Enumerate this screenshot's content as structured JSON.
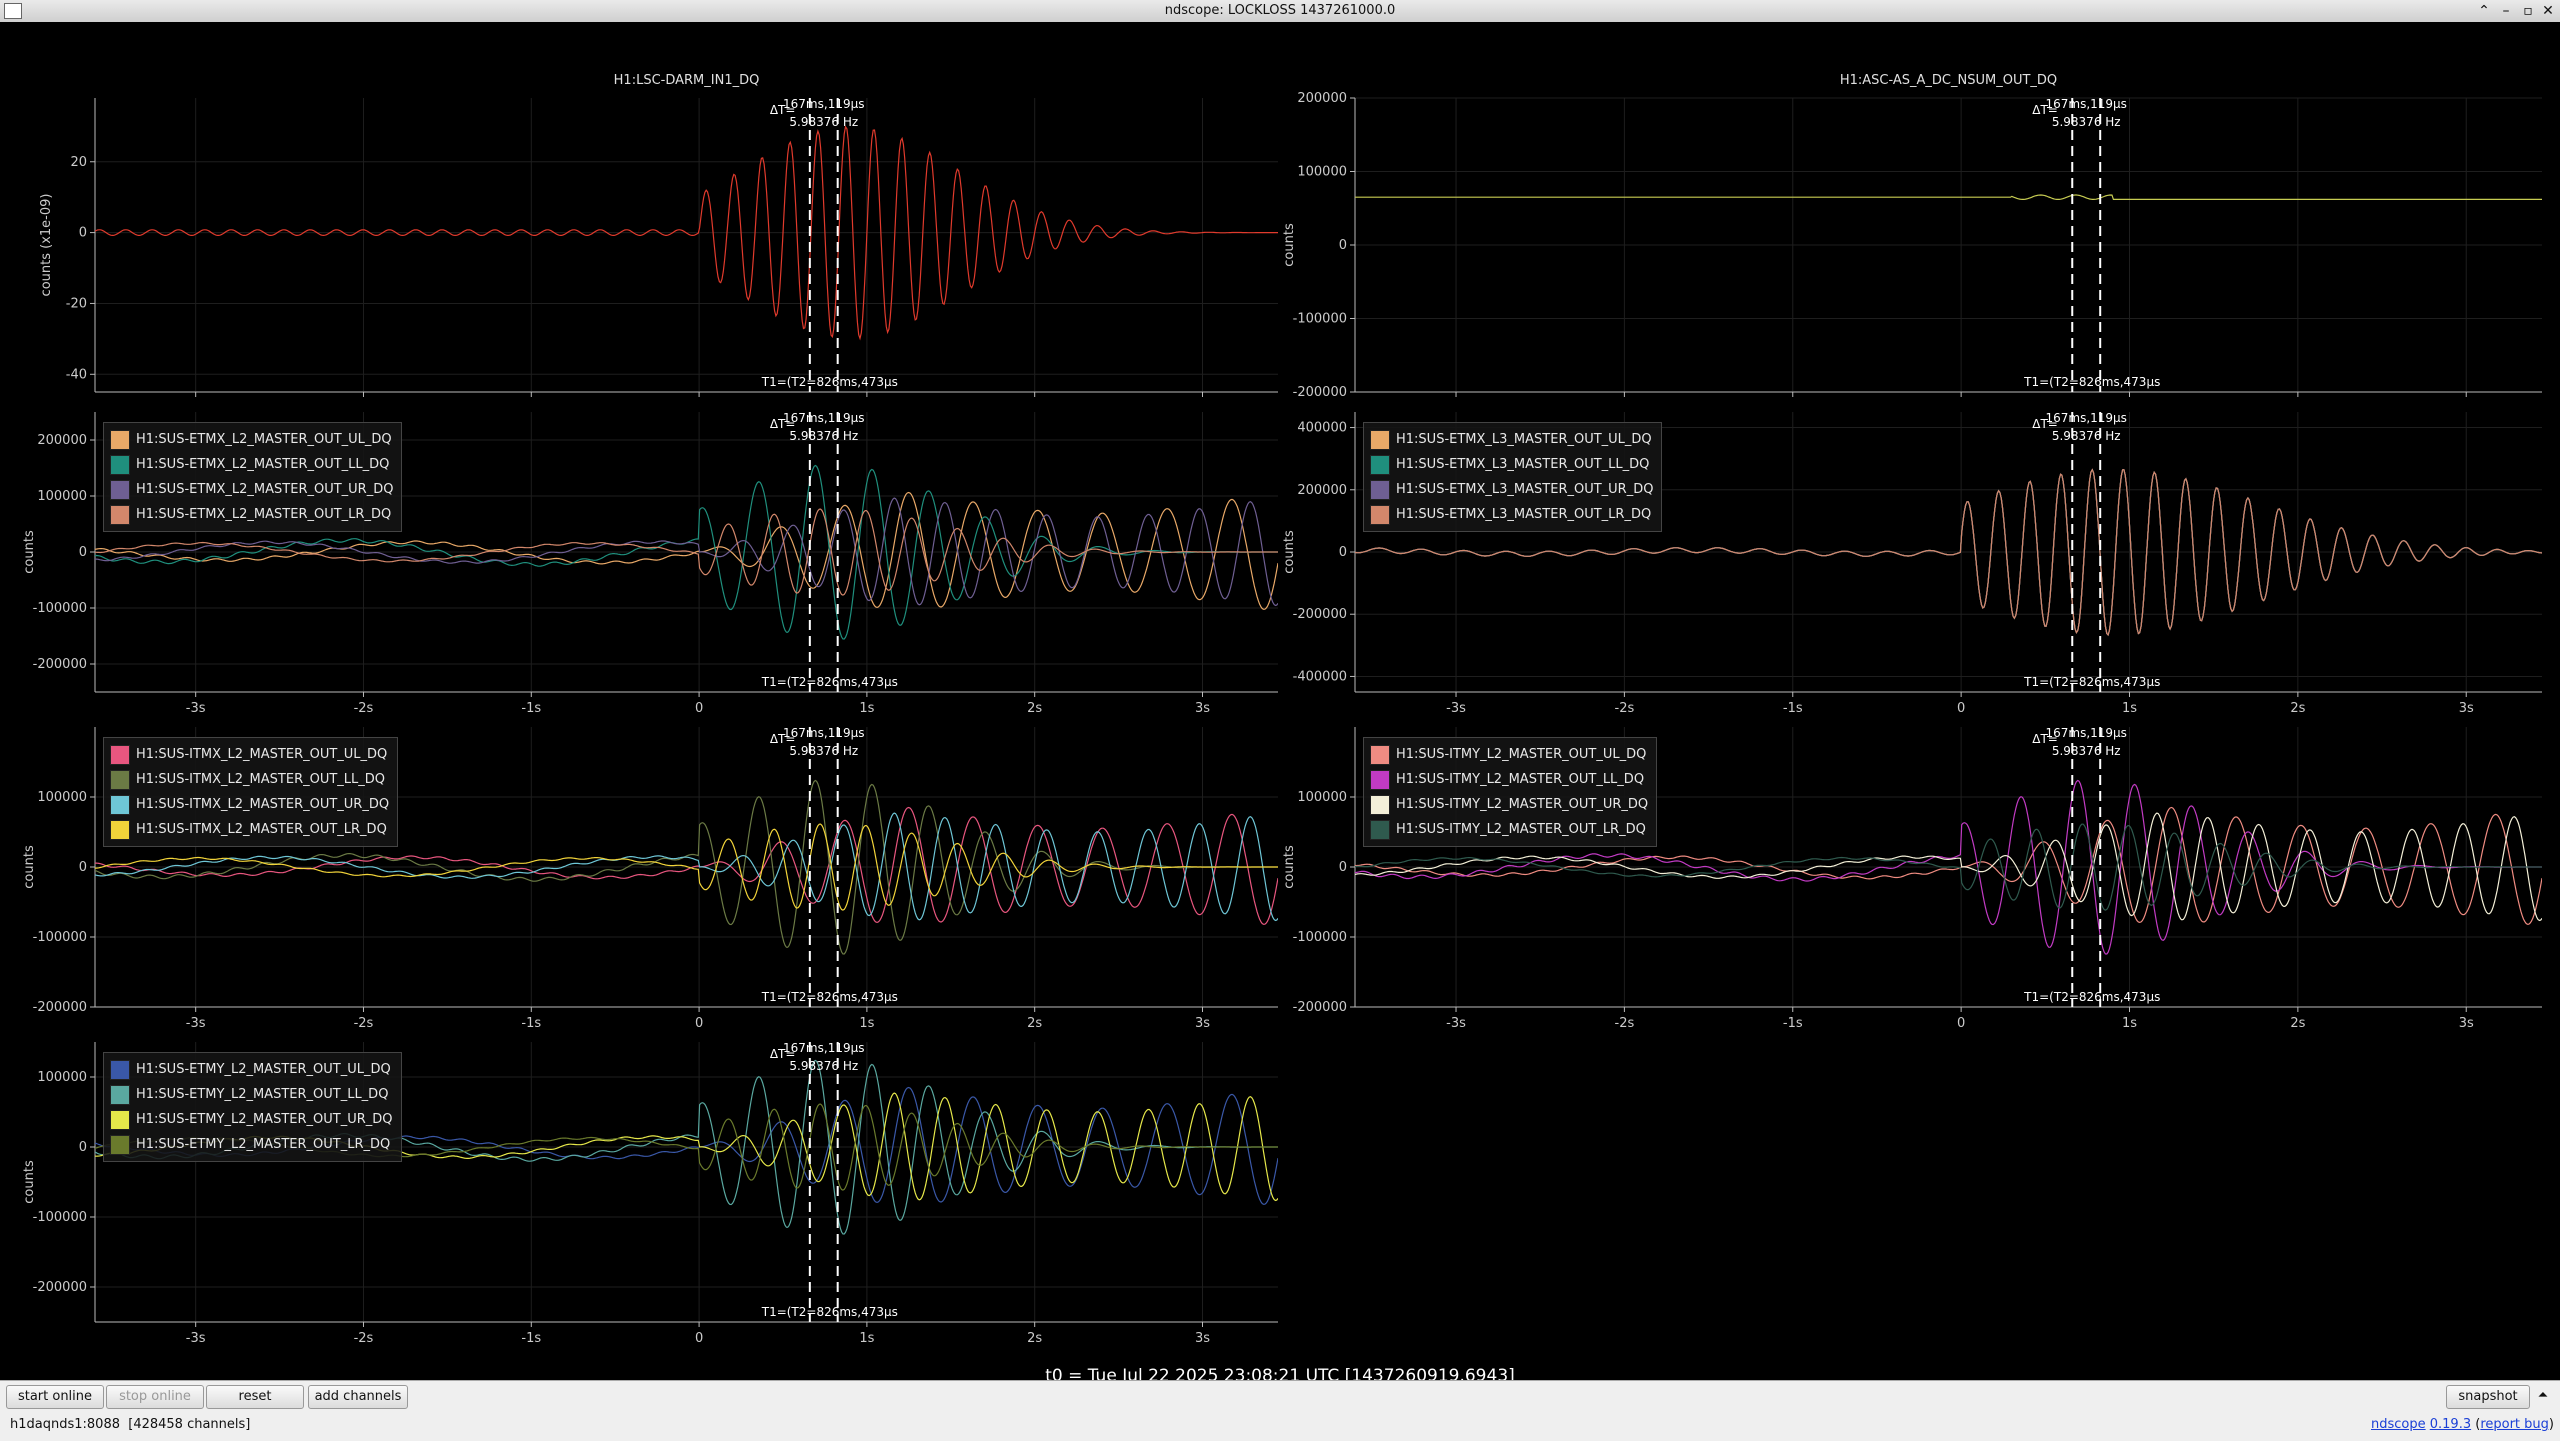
{
  "window": {
    "title": "ndscope: LOCKLOSS 1437261000.0"
  },
  "x_ticks": [
    "-3s",
    "-2s",
    "-1s",
    "0",
    "1s",
    "2s",
    "3s"
  ],
  "cursor": {
    "dt_prefix": "ΔT=",
    "dt_value": "167ms,119µs",
    "freq": "5.98376 Hz",
    "t_label": "T1=(T2=826ms,473µs"
  },
  "t0": "t0 = Tue Jul 22 2025 23:08:21 UTC [1437260919.6943]",
  "toolbar": {
    "start_online": "start online",
    "stop_online": "stop online",
    "reset": "reset",
    "add_channels": "add channels",
    "snapshot": "snapshot"
  },
  "status": {
    "server": "h1daqnds1:8088",
    "channels": "[428458 channels]",
    "version_prefix": "ndscope",
    "version": "0.19.3",
    "report": "report bug"
  },
  "colors": {
    "darm": "#e03a2c",
    "nsum": "#c7cc52"
  },
  "panels": [
    {
      "id": "p1",
      "title": "H1:LSC-DARM_IN1_DQ",
      "ylabel": "counts (x1e-09)",
      "yticks": [
        "20",
        "0",
        "-20",
        "-40"
      ],
      "ylim": [
        -45,
        38
      ],
      "legend": []
    },
    {
      "id": "p2",
      "title": "H1:ASC-AS_A_DC_NSUM_OUT_DQ",
      "ylabel": "counts",
      "yticks": [
        "200000",
        "100000",
        "0",
        "-100000",
        "-200000"
      ],
      "ylim": [
        -200000,
        200000
      ],
      "legend": []
    },
    {
      "id": "p3",
      "title": "",
      "ylabel": "counts",
      "yticks": [
        "200000",
        "100000",
        "0",
        "-100000",
        "-200000"
      ],
      "ylim": [
        -250000,
        250000
      ],
      "legend": [
        {
          "name": "H1:SUS-ETMX_L2_MASTER_OUT_UL_DQ",
          "color": "#e9a968"
        },
        {
          "name": "H1:SUS-ETMX_L2_MASTER_OUT_LL_DQ",
          "color": "#1f8f7d"
        },
        {
          "name": "H1:SUS-ETMX_L2_MASTER_OUT_UR_DQ",
          "color": "#6f5f93"
        },
        {
          "name": "H1:SUS-ETMX_L2_MASTER_OUT_LR_DQ",
          "color": "#d2876b"
        }
      ]
    },
    {
      "id": "p4",
      "title": "",
      "ylabel": "counts",
      "yticks": [
        "400000",
        "200000",
        "0",
        "-200000",
        "-400000"
      ],
      "ylim": [
        -450000,
        450000
      ],
      "legend": [
        {
          "name": "H1:SUS-ETMX_L3_MASTER_OUT_UL_DQ",
          "color": "#e9a968"
        },
        {
          "name": "H1:SUS-ETMX_L3_MASTER_OUT_LL_DQ",
          "color": "#1f8f7d"
        },
        {
          "name": "H1:SUS-ETMX_L3_MASTER_OUT_UR_DQ",
          "color": "#6f5f93"
        },
        {
          "name": "H1:SUS-ETMX_L3_MASTER_OUT_LR_DQ",
          "color": "#d2876b"
        }
      ]
    },
    {
      "id": "p5",
      "title": "",
      "ylabel": "counts",
      "yticks": [
        "100000",
        "0",
        "-100000",
        "-200000"
      ],
      "ylim": [
        -200000,
        200000
      ],
      "legend": [
        {
          "name": "H1:SUS-ITMX_L2_MASTER_OUT_UL_DQ",
          "color": "#e8567f"
        },
        {
          "name": "H1:SUS-ITMX_L2_MASTER_OUT_LL_DQ",
          "color": "#6b7a45"
        },
        {
          "name": "H1:SUS-ITMX_L2_MASTER_OUT_UR_DQ",
          "color": "#6ec6d6"
        },
        {
          "name": "H1:SUS-ITMX_L2_MASTER_OUT_LR_DQ",
          "color": "#f2d43a"
        }
      ]
    },
    {
      "id": "p6",
      "title": "",
      "ylabel": "counts",
      "yticks": [
        "100000",
        "0",
        "-100000",
        "-200000"
      ],
      "ylim": [
        -200000,
        200000
      ],
      "legend": [
        {
          "name": "H1:SUS-ITMY_L2_MASTER_OUT_UL_DQ",
          "color": "#f08c82"
        },
        {
          "name": "H1:SUS-ITMY_L2_MASTER_OUT_LL_DQ",
          "color": "#c23bc4"
        },
        {
          "name": "H1:SUS-ITMY_L2_MASTER_OUT_UR_DQ",
          "color": "#f4f0d8"
        },
        {
          "name": "H1:SUS-ITMY_L2_MASTER_OUT_LR_DQ",
          "color": "#2f5a4e"
        }
      ]
    },
    {
      "id": "p7",
      "title": "",
      "ylabel": "counts",
      "yticks": [
        "100000",
        "0",
        "-100000",
        "-200000"
      ],
      "ylim": [
        -250000,
        150000
      ],
      "legend": [
        {
          "name": "H1:SUS-ETMY_L2_MASTER_OUT_UL_DQ",
          "color": "#3a58a8"
        },
        {
          "name": "H1:SUS-ETMY_L2_MASTER_OUT_LL_DQ",
          "color": "#5aa8a0"
        },
        {
          "name": "H1:SUS-ETMY_L2_MASTER_OUT_UR_DQ",
          "color": "#e6e84a"
        },
        {
          "name": "H1:SUS-ETMY_L2_MASTER_OUT_LR_DQ",
          "color": "#6a7a2c"
        }
      ]
    }
  ]
}
